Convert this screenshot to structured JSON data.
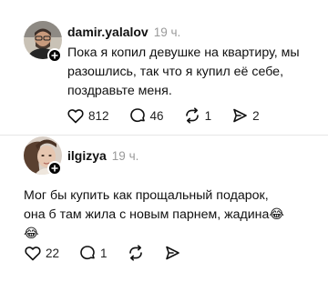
{
  "posts": [
    {
      "username": "damir.yalalov",
      "time": "19 ч.",
      "text_lines": [
        "Пока я копил девушке на квартиру, мы",
        "разошлись, так что я купил её себе,",
        "поздравьте меня."
      ],
      "likes": "812",
      "comments": "46",
      "reposts": "1",
      "shares": "2"
    },
    {
      "username": "ilgizya",
      "time": "19 ч.",
      "text_lines": [
        "Мог бы купить как прощальный подарок,",
        "она б там жила с новым парнем, жадина😂",
        "😂"
      ],
      "likes": "22",
      "comments": "1"
    }
  ],
  "icons": {
    "like": "heart-icon",
    "comment": "comment-icon",
    "repost": "repost-icon",
    "share": "send-icon",
    "follow": "plus-icon"
  }
}
